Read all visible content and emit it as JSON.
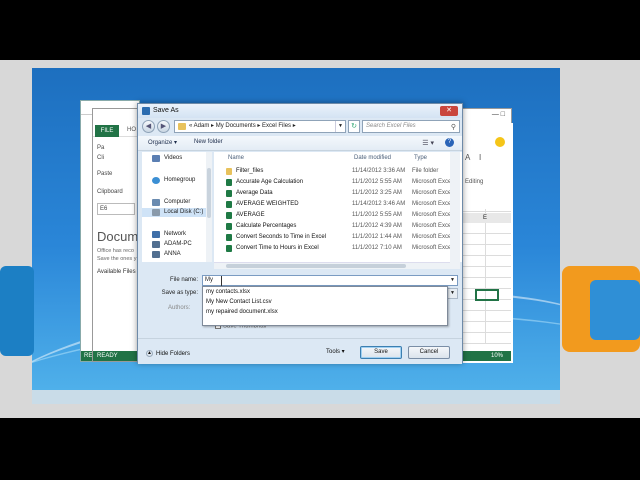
{
  "excel": {
    "file_tab": "FILE",
    "home_tab_partial": "HO",
    "paste": "Paste",
    "clipboard": "Clipboard",
    "name_box": "E6",
    "document_recovery_title": "Document",
    "recovery_text_1": "Office has reco",
    "recovery_text_2": "Save the ones y",
    "available_files": "Available Files",
    "editing": "Editing",
    "column_e": "E",
    "status": "READY",
    "zoom": "10%",
    "left_trunc_1": "Pa",
    "left_trunc_2": "Cli",
    "window_buttons": "— □",
    "back_status": "RE",
    "ribbon_a": "A",
    "ribbon_i": "I"
  },
  "dialog": {
    "title": "Save As",
    "close_glyph": "✕",
    "back_glyph": "◀",
    "forward_glyph": "▶",
    "address": "« Adam ▸ My Documents ▸ Excel Files ▸",
    "address_dropdown": "▼",
    "refresh_glyph": "↻",
    "search_placeholder": "Search Excel Files",
    "search_icon": "⚲",
    "organize": "Organize ▾",
    "new_folder": "New folder",
    "views_glyph": "☰ ▾",
    "help_glyph": "?",
    "nav_items": [
      {
        "label": "Videos"
      },
      {
        "label": "Homegroup"
      },
      {
        "label": "Computer"
      },
      {
        "label": "Local Disk (C:)"
      },
      {
        "label": "Network"
      },
      {
        "label": "ADAM-PC"
      },
      {
        "label": "ANNA"
      }
    ],
    "columns": {
      "name": "Name",
      "date": "Date modified",
      "type": "Type"
    },
    "files": [
      {
        "name": "Filter_files",
        "date": "11/14/2012 3:36 AM",
        "type": "File folder"
      },
      {
        "name": "Accurate Age Calculation",
        "date": "11/1/2012 5:55 AM",
        "type": "Microsoft Excel"
      },
      {
        "name": "Average Data",
        "date": "11/1/2012 3:25 AM",
        "type": "Microsoft Excel"
      },
      {
        "name": "AVERAGE WEIGHTED",
        "date": "11/14/2012 3:46 AM",
        "type": "Microsoft Excel"
      },
      {
        "name": "AVERAGE",
        "date": "11/1/2012 5:55 AM",
        "type": "Microsoft Excel"
      },
      {
        "name": "Calculate Percentages",
        "date": "11/1/2012 4:39 AM",
        "type": "Microsoft Excel"
      },
      {
        "name": "Convert Seconds to Time in Excel",
        "date": "11/1/2012 1:44 AM",
        "type": "Microsoft Excel"
      },
      {
        "name": "Convert Time to Hours in Excel",
        "date": "11/1/2012 7:10 AM",
        "type": "Microsoft Excel"
      }
    ],
    "file_name_label": "File name:",
    "file_name_value": "My",
    "field_dropdown": "▼",
    "save_as_type_label": "Save as type:",
    "authors_label": "Authors:",
    "suggestions": [
      "my contacts.xlsx",
      "My New Contact List.csv",
      "my repaired document.xlsx"
    ],
    "save_thumbnail": "Save Thumbnail",
    "hide_folders_glyph": "▲",
    "hide_folders": "Hide Folders",
    "tools": "Tools ▾",
    "save_button": "Save",
    "cancel_button": "Cancel"
  },
  "colors": {
    "excel_green": "#217346",
    "dialog_bg": "#dce8f4",
    "folder": "#e8c25c",
    "excel_file": "#1f7a45"
  }
}
